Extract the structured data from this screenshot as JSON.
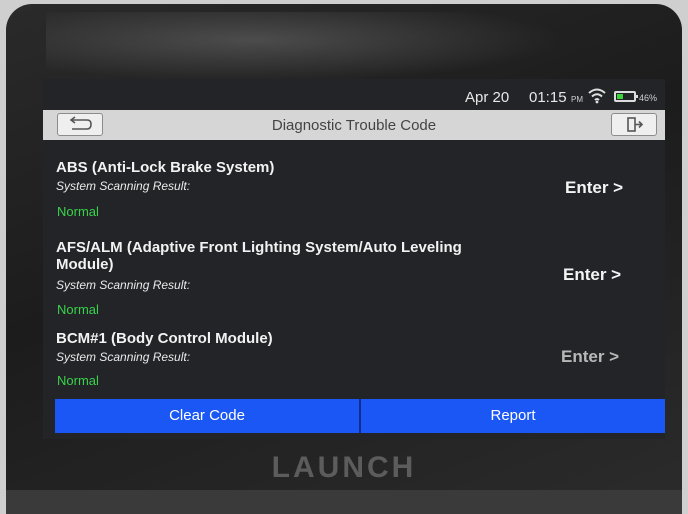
{
  "status_bar": {
    "date": "Apr 20",
    "time": "01:15",
    "ampm": "PM",
    "battery_percent": "46%",
    "battery_level": 0.46,
    "wifi_icon": "wifi-icon",
    "battery_icon": "battery-icon"
  },
  "header": {
    "title": "Diagnostic Trouble Code",
    "back_icon": "back-arrow-icon",
    "exit_icon": "exit-icon"
  },
  "modules": [
    {
      "name": "ABS (Anti-Lock Brake System)",
      "result_label": "System Scanning Result:",
      "result": "Normal",
      "action": "Enter >"
    },
    {
      "name": "AFS/ALM (Adaptive Front Lighting System/Auto Leveling Module)",
      "result_label": "System Scanning Result:",
      "result": "Normal",
      "action": "Enter >"
    },
    {
      "name": "BCM#1 (Body Control Module)",
      "result_label": "System Scanning Result:",
      "result": "Normal",
      "action": "Enter >"
    }
  ],
  "footer": {
    "clear_code": "Clear Code",
    "report": "Report"
  },
  "device": {
    "brand": "LAUNCH"
  },
  "colors": {
    "accent_blue": "#1a57f5",
    "normal_green": "#39d24a",
    "screen_bg": "#222428",
    "titlebar_bg": "#d6d6d6"
  }
}
